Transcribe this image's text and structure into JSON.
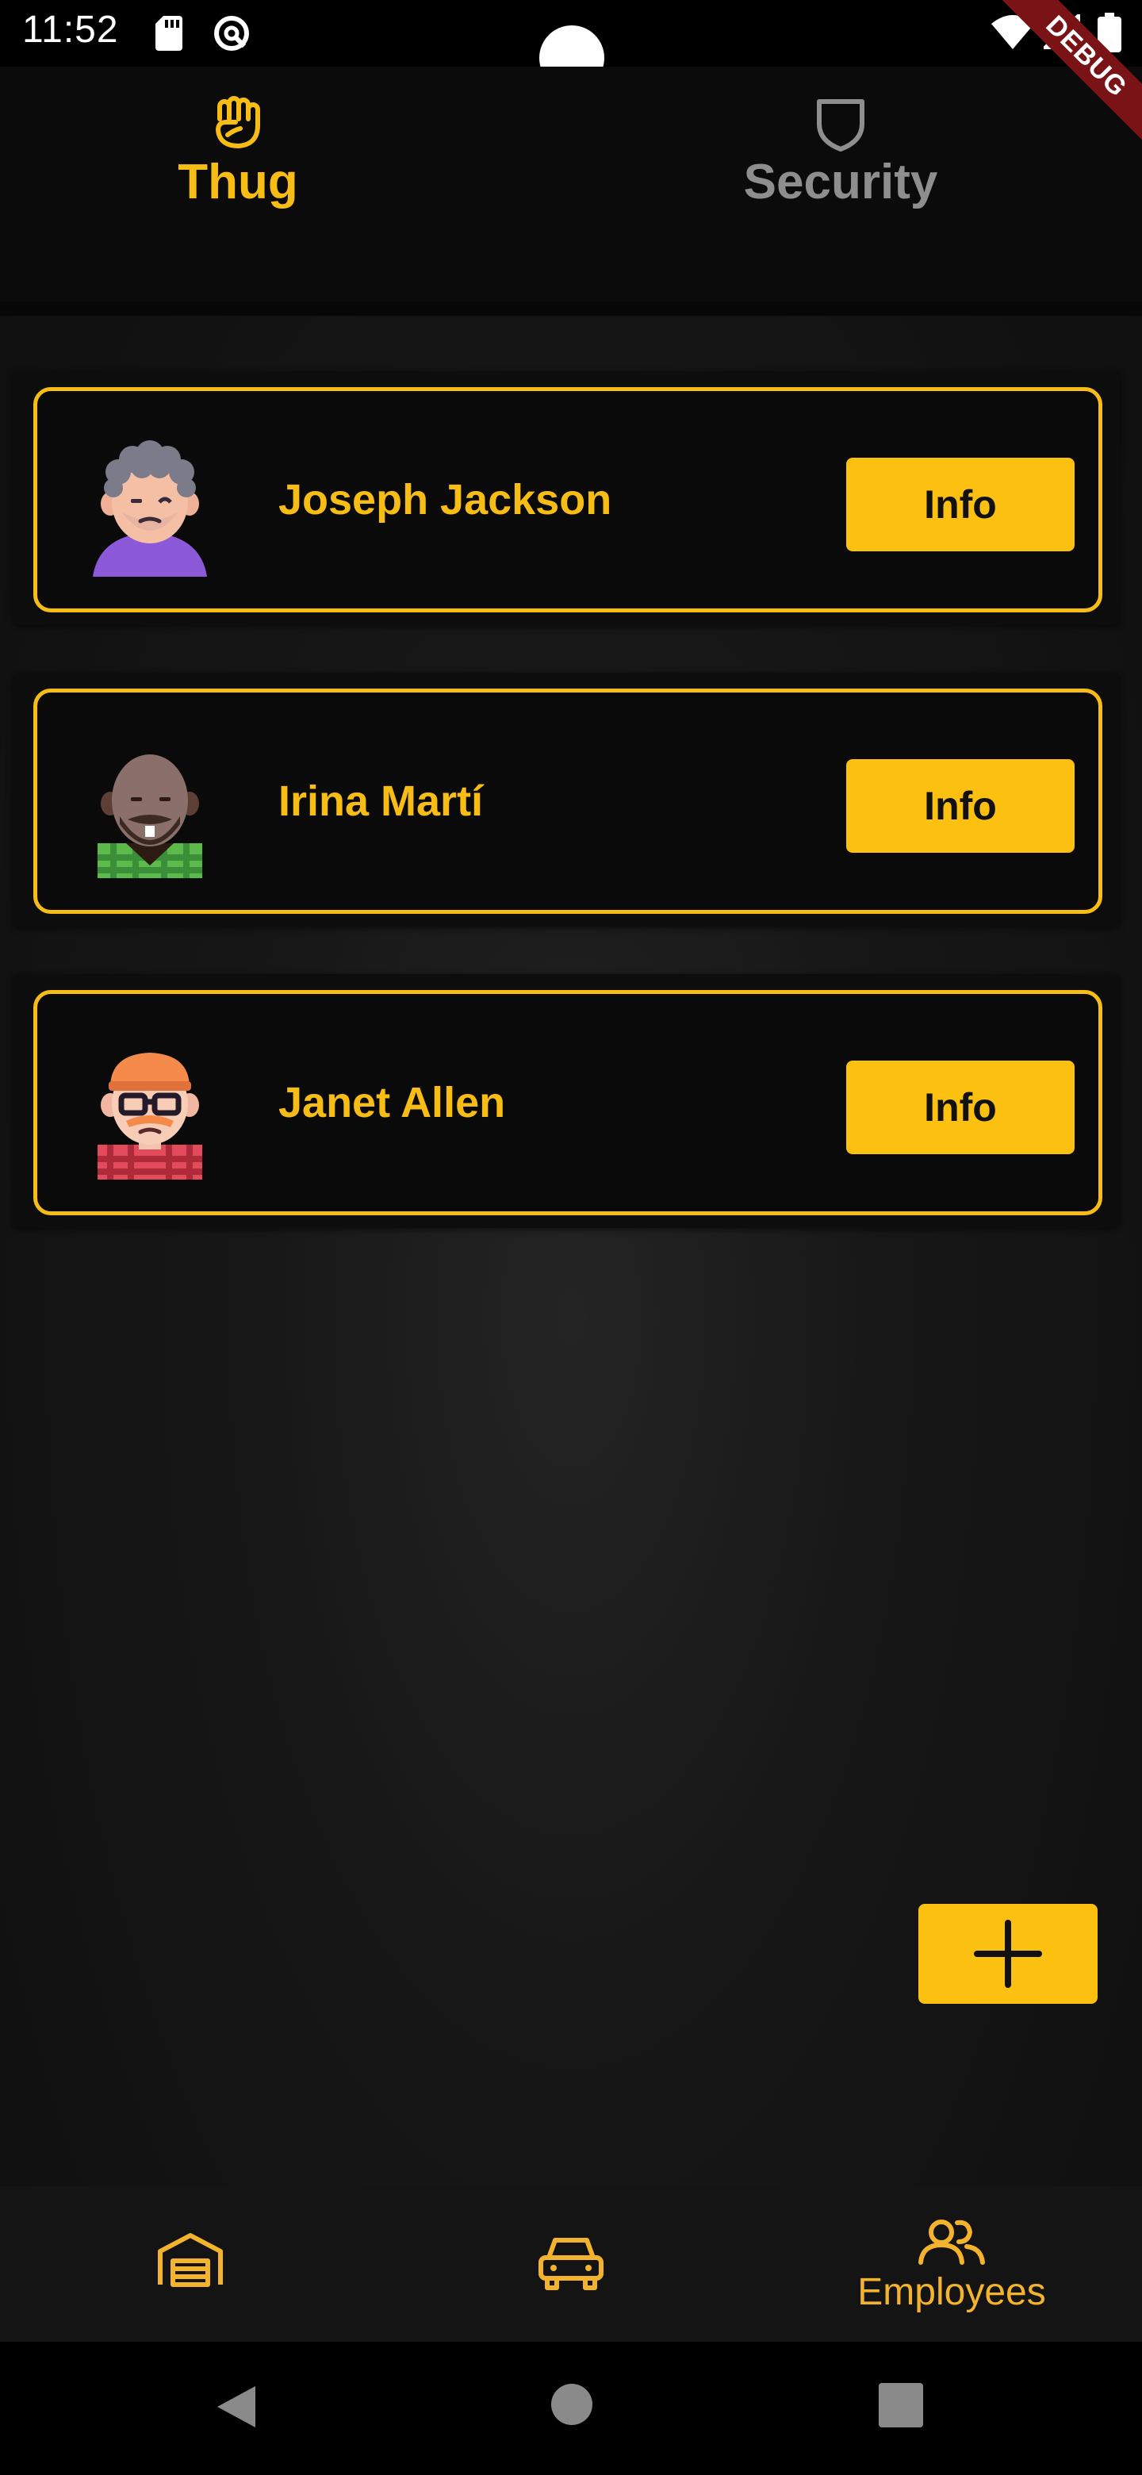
{
  "status_bar": {
    "time": "11:52"
  },
  "debug_banner": "DEBUG",
  "top_tabs": [
    {
      "label": "Thug",
      "icon": "fist-icon",
      "selected": true
    },
    {
      "label": "Security",
      "icon": "shield-icon",
      "selected": false
    }
  ],
  "employees": [
    {
      "name": "Joseph Jackson",
      "button": "Info"
    },
    {
      "name": "Irina Martí",
      "button": "Info"
    },
    {
      "name": "Janet Allen",
      "button": "Info"
    }
  ],
  "fab": {
    "icon": "plus-icon"
  },
  "bottom_nav": [
    {
      "icon": "garage-icon",
      "label": ""
    },
    {
      "icon": "car-icon",
      "label": ""
    },
    {
      "icon": "users-icon",
      "label": "Employees",
      "selected": true
    }
  ],
  "colors": {
    "accent": "#f7bd14",
    "button": "#fcc010",
    "inactive": "#8e8e8e",
    "background": "#0b0b0b"
  }
}
